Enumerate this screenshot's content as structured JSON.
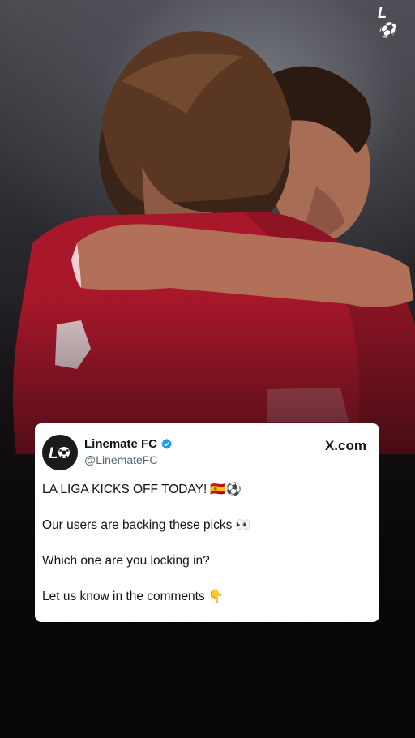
{
  "story": {
    "corner_logo": "L⚽",
    "background_subject": "two-players-embracing"
  },
  "tweet": {
    "display_name": "Linemate FC",
    "handle": "@LinemateFC",
    "avatar_text": "L⚽",
    "source_domain": "X.com",
    "lines": [
      "LA LIGA KICKS OFF TODAY!",
      "Our users are backing these picks",
      "Which one are you locking in?",
      "Let us know in the comments"
    ],
    "emojis": {
      "line1": "🇪🇸⚽",
      "line2": "👀",
      "line4": "👇"
    }
  },
  "colors": {
    "verified": "#1d9bf0",
    "jersey_red": "#c3192e",
    "card_bg": "#ffffff"
  }
}
